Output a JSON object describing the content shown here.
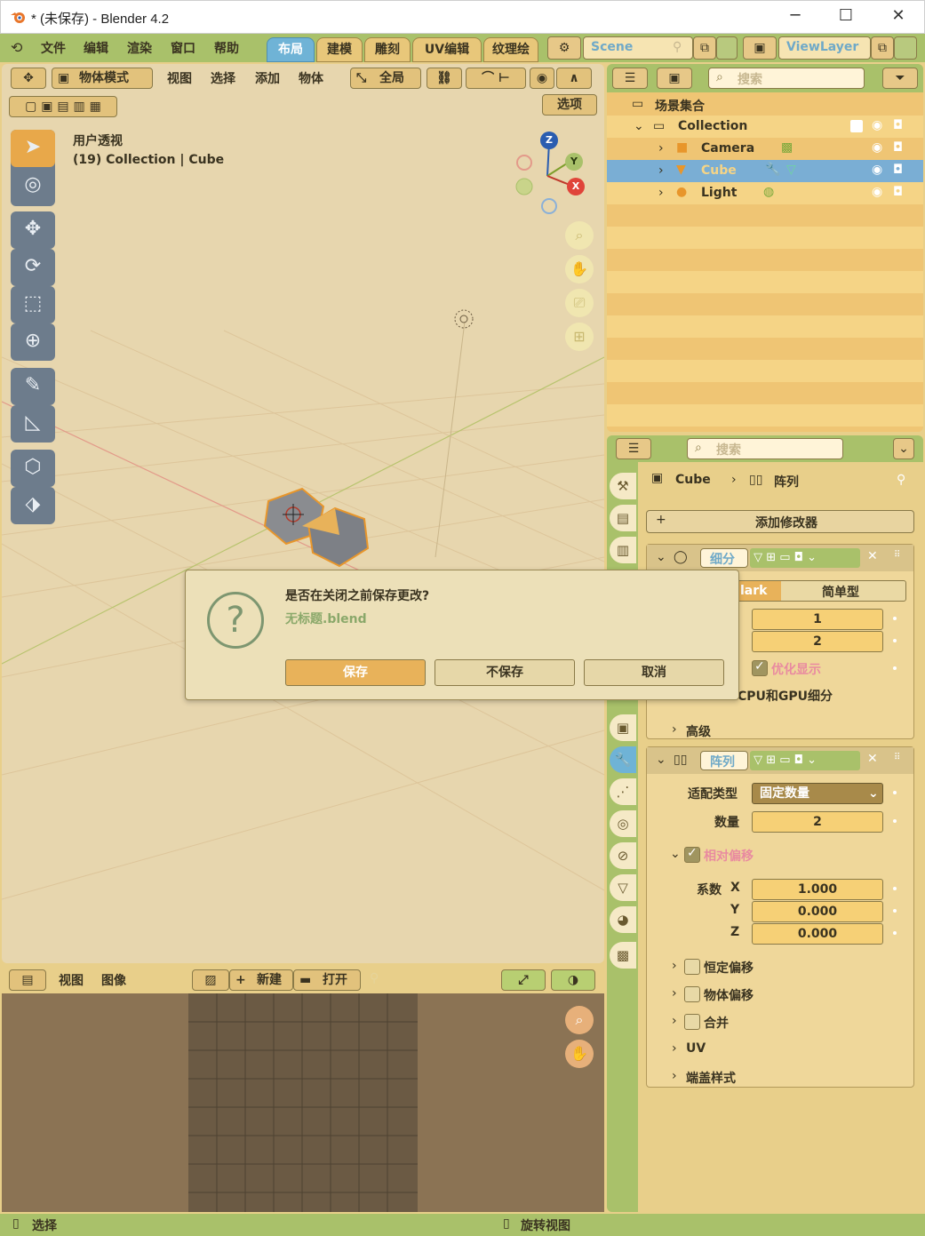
{
  "window": {
    "title": "* (未保存) - Blender 4.2",
    "controls": [
      "─",
      "☐",
      "✕"
    ]
  },
  "menubar": {
    "items": [
      "文件",
      "编辑",
      "渲染",
      "窗口",
      "帮助"
    ]
  },
  "workspaces": {
    "tabs": [
      "布局",
      "建模",
      "雕刻",
      "UV编辑",
      "纹理绘"
    ],
    "active": "布局"
  },
  "scene": {
    "name": "Scene"
  },
  "viewlayer": {
    "name": "ViewLayer"
  },
  "viewport": {
    "mode": "物体模式",
    "menus": [
      "视图",
      "选择",
      "添加",
      "物体"
    ],
    "orientation": "全局",
    "options_label": "选项",
    "overlay_title": "用户透视",
    "overlay_info": "(19) Collection | Cube",
    "gizmo_axes": [
      "Z",
      "Y",
      "X"
    ]
  },
  "dialog": {
    "question": "是否在关闭之前保存更改?",
    "filename": "无标题.blend",
    "buttons": {
      "save": "保存",
      "dont_save": "不保存",
      "cancel": "取消"
    }
  },
  "image_editor": {
    "menus": [
      "视图",
      "图像"
    ],
    "new_label": "新建",
    "open_label": "打开"
  },
  "outliner": {
    "search_placeholder": "搜索",
    "root": "场景集合",
    "collection": "Collection",
    "objects": [
      {
        "name": "Camera",
        "selected": false
      },
      {
        "name": "Cube",
        "selected": true
      },
      {
        "name": "Light",
        "selected": false
      }
    ]
  },
  "properties": {
    "search_placeholder": "搜索",
    "breadcrumb": {
      "object": "Cube",
      "modifier": "阵列"
    },
    "add_modifier": "添加修改器",
    "subsurf": {
      "name": "细分",
      "type_partial": "lark",
      "type_simple": "简单型",
      "levels_viewport": "1",
      "levels_render": "2",
      "optimal_display": "优化显示",
      "gpu_partial": "CPU和GPU细分",
      "advanced": "高级"
    },
    "array": {
      "name": "阵列",
      "fit_type_label": "适配类型",
      "fit_type_value": "固定数量",
      "count_label": "数量",
      "count_value": "2",
      "relative_offset": "相对偏移",
      "factor_label": "系数",
      "axes": [
        "X",
        "Y",
        "Z"
      ],
      "factors": [
        "1.000",
        "0.000",
        "0.000"
      ],
      "constant_offset": "恒定偏移",
      "object_offset": "物体偏移",
      "merge": "合并",
      "uv": "UV",
      "caps": "端盖样式"
    }
  },
  "statusbar": {
    "left": "选择",
    "mid": "旋转视图"
  }
}
